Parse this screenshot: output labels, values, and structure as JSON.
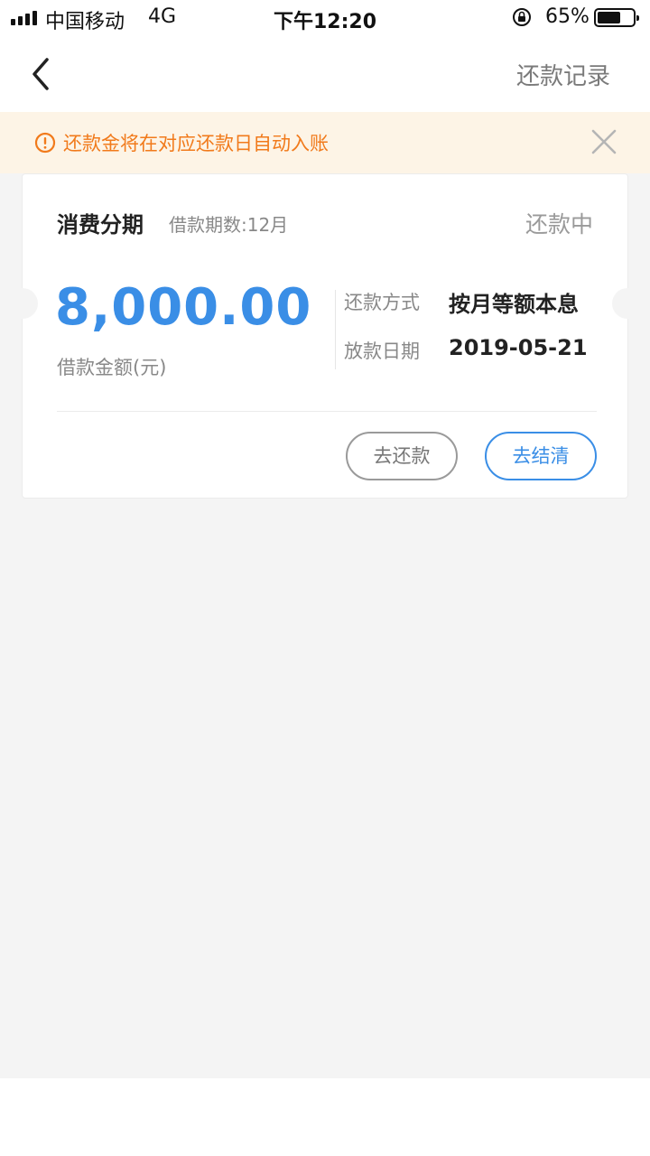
{
  "status_bar": {
    "carrier": "中国移动",
    "network": "4G",
    "time": "下午12:20",
    "battery_percent": "65%",
    "battery_level": 0.65,
    "icons": [
      "signal-icon",
      "orientation-lock-icon",
      "battery-icon"
    ]
  },
  "nav": {
    "back_icon": "chevron-left-icon",
    "records_label": "还款记录"
  },
  "notice": {
    "icon": "warning-circle-icon",
    "text": "还款金将在对应还款日自动入账",
    "close_icon": "close-icon"
  },
  "loan_card": {
    "product_name": "消费分期",
    "term_text": "借款期数:12月",
    "status": "还款中",
    "amount": "8,000.00",
    "amount_label": "借款金额(元)",
    "repay_method_label": "还款方式",
    "repay_method_value": "按月等额本息",
    "disburse_date_label": "放款日期",
    "disburse_date_value": "2019-05-21",
    "repay_button": "去还款",
    "settle_button": "去结清"
  },
  "colors": {
    "accent_blue": "#3a8ee6",
    "notice_orange": "#f17a1b",
    "notice_bg": "#fdf4e6",
    "page_bg": "#f4f4f4"
  }
}
